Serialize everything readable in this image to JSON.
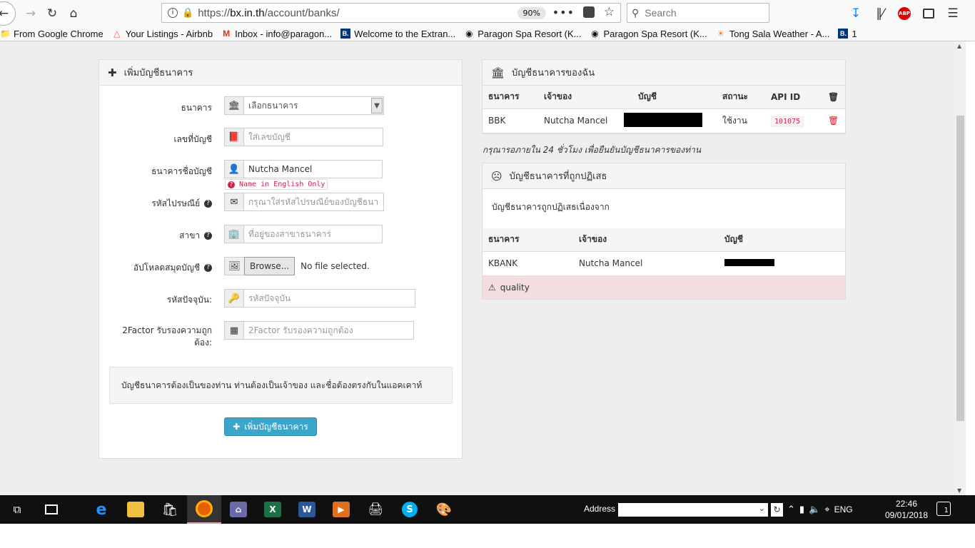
{
  "browser": {
    "url_scheme": "https://",
    "url_host": "bx.in.th",
    "url_path": "/account/banks/",
    "zoom": "90%",
    "search_placeholder": "Search",
    "bookmarks": [
      {
        "label": "From Google Chrome",
        "icon": "folder-icon"
      },
      {
        "label": "Your Listings - Airbnb",
        "icon": "airbnb-icon"
      },
      {
        "label": "Inbox - info@paragon...",
        "icon": "gmail-icon"
      },
      {
        "label": "Welcome to the Extran...",
        "icon": "booking-icon"
      },
      {
        "label": "Paragon Spa Resort (K...",
        "icon": "tripadvisor-icon"
      },
      {
        "label": "Paragon Spa Resort (K...",
        "icon": "tripadvisor-icon"
      },
      {
        "label": "Tong Sala Weather - A...",
        "icon": "weather-icon"
      },
      {
        "label": "1",
        "icon": "booking-icon"
      }
    ]
  },
  "add_form": {
    "title": "เพิ่มบัญชีธนาคาร",
    "bank_label": "ธนาคาร",
    "bank_select": "เลือกธนาคาร",
    "account_no_label": "เลขที่บัญชี",
    "account_no_placeholder": "ใส่เลขบัญชี",
    "account_name_label": "ธนาคารชื่อบัญชี",
    "account_name_value": "Nutcha Mancel",
    "name_hint": "Name in English Only",
    "postcode_label": "รหัสไปรษณีย์",
    "postcode_placeholder": "กรุณาใส่รหัสไปรษณีย์ของบัญชีธนา",
    "branch_label": "สาขา",
    "branch_placeholder": "ที่อยู่ของสาขาธนาคาร",
    "upload_label": "อัปโหลดสมุดบัญชี",
    "browse_label": "Browse...",
    "no_file": "No file selected.",
    "password_label": "รหัสปัจจุบัน:",
    "password_placeholder": "รหัสปัจจุบัน",
    "twofactor_label_1": "2Factor รับรองความถูก",
    "twofactor_label_2": "ต้อง:",
    "twofactor_placeholder": "2Factor รับรองความถูกต้อง",
    "notice": "บัญชีธนาคารต้องเป็นของท่าน ท่านต้องเป็นเจ้าของ และชื่อต้องตรงกับในแอคเคาท์",
    "submit_label": "เพิ่มบัญชีธนาคาร"
  },
  "my_accounts": {
    "title": "บัญชีธนาคารของฉัน",
    "headers": [
      "ธนาคาร",
      "เจ้าของ",
      "บัญชี",
      "สถานะ",
      "API ID"
    ],
    "rows": [
      {
        "bank": "BBK",
        "owner": "Nutcha Mancel",
        "status": "ใช้งาน",
        "api_id": "101075"
      }
    ],
    "note": "กรุณารอภายใน 24 ชั่วโมง เพื่อยืนยันบัญชีธนาคารของท่าน"
  },
  "rejected": {
    "title": "บัญชีธนาคารที่ถูกปฏิเสธ",
    "reason_text": "บัญชีธนาคารถูกปฏิเสธเนื่องจาก",
    "headers": [
      "ธนาคาร",
      "เจ้าของ",
      "บัญชี"
    ],
    "rows": [
      {
        "bank": "KBANK",
        "owner": "Nutcha Mancel"
      }
    ],
    "reason": "quality"
  },
  "taskbar": {
    "address_label": "Address",
    "language": "ENG",
    "time": "22:46",
    "date": "09/01/2018",
    "notifications": "1"
  }
}
